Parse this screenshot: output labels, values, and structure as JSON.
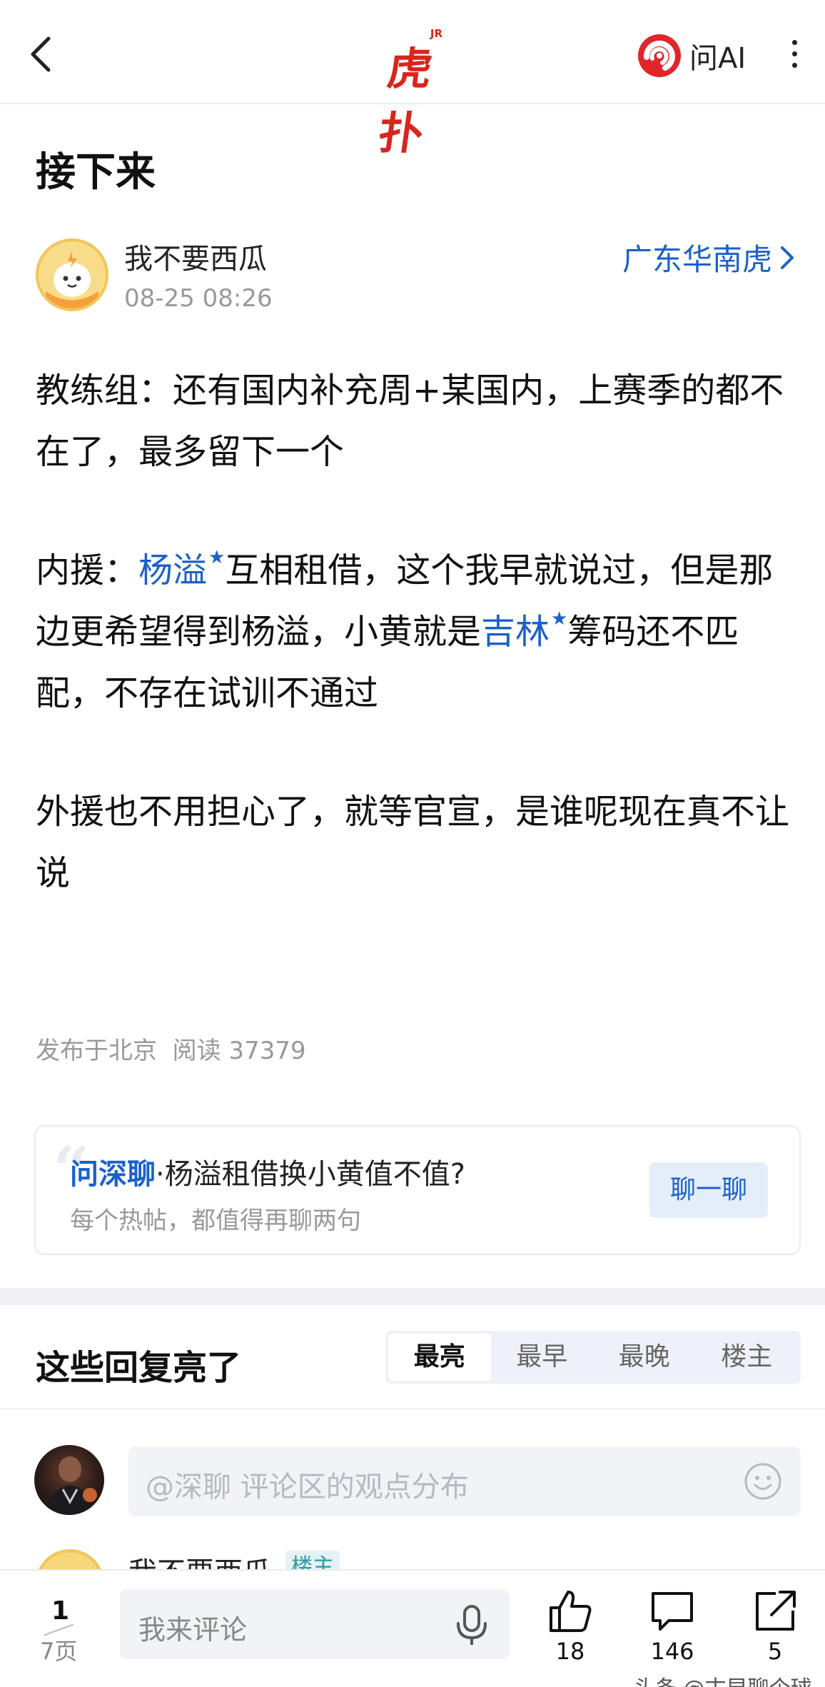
{
  "topbar": {
    "logo_text": "虎扑",
    "logo_sup": "JR",
    "ask_ai_label": "问AI"
  },
  "post": {
    "title": "接下来",
    "author": "我不要西瓜",
    "time": "08-25 08:26",
    "forum": "广东华南虎",
    "p1": "教练组：还有国内补充周+某国内，上赛季的都不在了，最多留下一个",
    "p2_a": "内援：",
    "p2_link1": "杨溢",
    "p2_b": "互相租借，这个我早就说过，但是那边更希望得到杨溢，小黄就是",
    "p2_link2": "吉林",
    "p2_c": "筹码还不匹配，不存在试训不通过",
    "p3": "外援也不用担心了，就等官宣，是谁呢现在真不让说",
    "location": "发布于北京",
    "reads": "阅读 37379"
  },
  "ai_card": {
    "brand": "问深聊",
    "question": "·杨溢租借换小黄值不值?",
    "subtitle": "每个热帖，都值得再聊两句",
    "button": "聊一聊"
  },
  "replies": {
    "title": "这些回复亮了",
    "tabs": [
      "最亮",
      "最早",
      "最晚",
      "楼主"
    ],
    "ask_placeholder": "@深聊 评论区的观点分布",
    "peek_name": "我不要西瓜",
    "peek_badge": "楼主"
  },
  "bottombar": {
    "page_current": "1",
    "page_total": "7页",
    "comment_placeholder": "我来评论",
    "likes": "18",
    "comments": "146",
    "shares": "5"
  },
  "watermark": "头条 @古早聊个球",
  "colors": {
    "link_blue": "#1a61c9",
    "brand_red": "#d9251d"
  }
}
